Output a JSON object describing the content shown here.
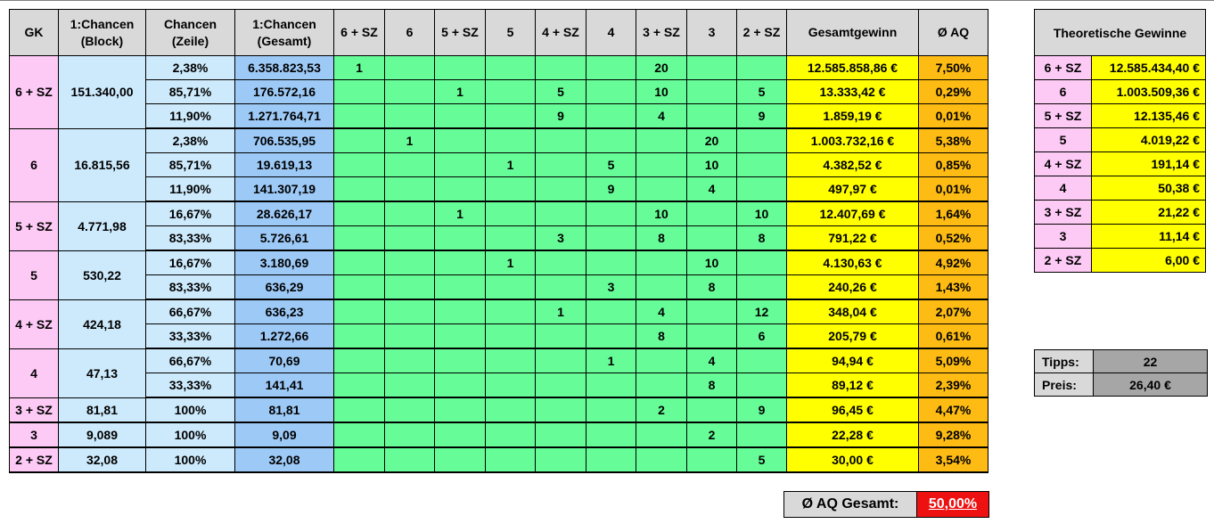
{
  "headers": [
    "GK",
    "1:Chancen\n(Block)",
    "Chancen\n(Zeile)",
    "1:Chancen\n(Gesamt)",
    "6 + SZ",
    "6",
    "5 + SZ",
    "5",
    "4 + SZ",
    "4",
    "3 + SZ",
    "3",
    "2 + SZ",
    "Gesamtgewinn",
    "Ø AQ"
  ],
  "groups": [
    {
      "gk": "6 + SZ",
      "block": "151.340,00",
      "rows": [
        {
          "zeile": "2,38%",
          "gesamt": "6.358.823,53",
          "counts": [
            "1",
            "",
            "",
            "",
            "",
            "",
            "20",
            "",
            ""
          ],
          "gewinn": "12.585.858,86 €",
          "aq": "7,50%"
        },
        {
          "zeile": "85,71%",
          "gesamt": "176.572,16",
          "counts": [
            "",
            "",
            "1",
            "",
            "5",
            "",
            "10",
            "",
            "5"
          ],
          "gewinn": "13.333,42 €",
          "aq": "0,29%"
        },
        {
          "zeile": "11,90%",
          "gesamt": "1.271.764,71",
          "counts": [
            "",
            "",
            "",
            "",
            "9",
            "",
            "4",
            "",
            "9"
          ],
          "gewinn": "1.859,19 €",
          "aq": "0,01%"
        }
      ]
    },
    {
      "gk": "6",
      "block": "16.815,56",
      "rows": [
        {
          "zeile": "2,38%",
          "gesamt": "706.535,95",
          "counts": [
            "",
            "1",
            "",
            "",
            "",
            "",
            "",
            "20",
            ""
          ],
          "gewinn": "1.003.732,16 €",
          "aq": "5,38%"
        },
        {
          "zeile": "85,71%",
          "gesamt": "19.619,13",
          "counts": [
            "",
            "",
            "",
            "1",
            "",
            "5",
            "",
            "10",
            ""
          ],
          "gewinn": "4.382,52 €",
          "aq": "0,85%"
        },
        {
          "zeile": "11,90%",
          "gesamt": "141.307,19",
          "counts": [
            "",
            "",
            "",
            "",
            "",
            "9",
            "",
            "4",
            ""
          ],
          "gewinn": "497,97 €",
          "aq": "0,01%"
        }
      ]
    },
    {
      "gk": "5 + SZ",
      "block": "4.771,98",
      "rows": [
        {
          "zeile": "16,67%",
          "gesamt": "28.626,17",
          "counts": [
            "",
            "",
            "1",
            "",
            "",
            "",
            "10",
            "",
            "10"
          ],
          "gewinn": "12.407,69 €",
          "aq": "1,64%"
        },
        {
          "zeile": "83,33%",
          "gesamt": "5.726,61",
          "counts": [
            "",
            "",
            "",
            "",
            "3",
            "",
            "8",
            "",
            "8"
          ],
          "gewinn": "791,22 €",
          "aq": "0,52%"
        }
      ]
    },
    {
      "gk": "5",
      "block": "530,22",
      "rows": [
        {
          "zeile": "16,67%",
          "gesamt": "3.180,69",
          "counts": [
            "",
            "",
            "",
            "1",
            "",
            "",
            "",
            "10",
            ""
          ],
          "gewinn": "4.130,63 €",
          "aq": "4,92%"
        },
        {
          "zeile": "83,33%",
          "gesamt": "636,29",
          "counts": [
            "",
            "",
            "",
            "",
            "",
            "3",
            "",
            "8",
            ""
          ],
          "gewinn": "240,26 €",
          "aq": "1,43%"
        }
      ]
    },
    {
      "gk": "4 + SZ",
      "block": "424,18",
      "rows": [
        {
          "zeile": "66,67%",
          "gesamt": "636,23",
          "counts": [
            "",
            "",
            "",
            "",
            "1",
            "",
            "4",
            "",
            "12"
          ],
          "gewinn": "348,04 €",
          "aq": "2,07%"
        },
        {
          "zeile": "33,33%",
          "gesamt": "1.272,66",
          "counts": [
            "",
            "",
            "",
            "",
            "",
            "",
            "8",
            "",
            "6"
          ],
          "gewinn": "205,79 €",
          "aq": "0,61%"
        }
      ]
    },
    {
      "gk": "4",
      "block": "47,13",
      "rows": [
        {
          "zeile": "66,67%",
          "gesamt": "70,69",
          "counts": [
            "",
            "",
            "",
            "",
            "",
            "1",
            "",
            "4",
            ""
          ],
          "gewinn": "94,94 €",
          "aq": "5,09%"
        },
        {
          "zeile": "33,33%",
          "gesamt": "141,41",
          "counts": [
            "",
            "",
            "",
            "",
            "",
            "",
            "",
            "8",
            ""
          ],
          "gewinn": "89,12 €",
          "aq": "2,39%"
        }
      ]
    },
    {
      "gk": "3 + SZ",
      "block": "81,81",
      "rows": [
        {
          "zeile": "100%",
          "gesamt": "81,81",
          "counts": [
            "",
            "",
            "",
            "",
            "",
            "",
            "2",
            "",
            "9"
          ],
          "gewinn": "96,45 €",
          "aq": "4,47%"
        }
      ]
    },
    {
      "gk": "3",
      "block": "9,089",
      "rows": [
        {
          "zeile": "100%",
          "gesamt": "9,09",
          "counts": [
            "",
            "",
            "",
            "",
            "",
            "",
            "",
            "2",
            ""
          ],
          "gewinn": "22,28 €",
          "aq": "9,28%"
        }
      ]
    },
    {
      "gk": "2 + SZ",
      "block": "32,08",
      "rows": [
        {
          "zeile": "100%",
          "gesamt": "32,08",
          "counts": [
            "",
            "",
            "",
            "",
            "",
            "",
            "",
            "",
            "5"
          ],
          "gewinn": "30,00 €",
          "aq": "3,54%"
        }
      ]
    }
  ],
  "theoretical": {
    "title": "Theoretische Gewinne",
    "rows": [
      {
        "class": "6 + SZ",
        "value": "12.585.434,40 €"
      },
      {
        "class": "6",
        "value": "1.003.509,36 €"
      },
      {
        "class": "5 + SZ",
        "value": "12.135,46 €"
      },
      {
        "class": "5",
        "value": "4.019,22 €"
      },
      {
        "class": "4 + SZ",
        "value": "191,14 €"
      },
      {
        "class": "4",
        "value": "50,38 €"
      },
      {
        "class": "3 + SZ",
        "value": "21,22 €"
      },
      {
        "class": "3",
        "value": "11,14 €"
      },
      {
        "class": "2 + SZ",
        "value": "6,00 €"
      }
    ]
  },
  "summary": {
    "tipps_label": "Tipps:",
    "tipps_value": "22",
    "preis_label": "Preis:",
    "preis_value": "26,40 €"
  },
  "aq_total": {
    "label": "Ø AQ Gesamt:",
    "value": "50,00%"
  },
  "colors": {
    "pink": "#fdc9f5",
    "light_blue": "#cdeafc",
    "mid_blue": "#9dc9f6",
    "green": "#66fd98",
    "yellow": "#ffff00",
    "orange": "#fdbb13",
    "red": "#ee1111",
    "header_gray": "#d9d9d9"
  }
}
